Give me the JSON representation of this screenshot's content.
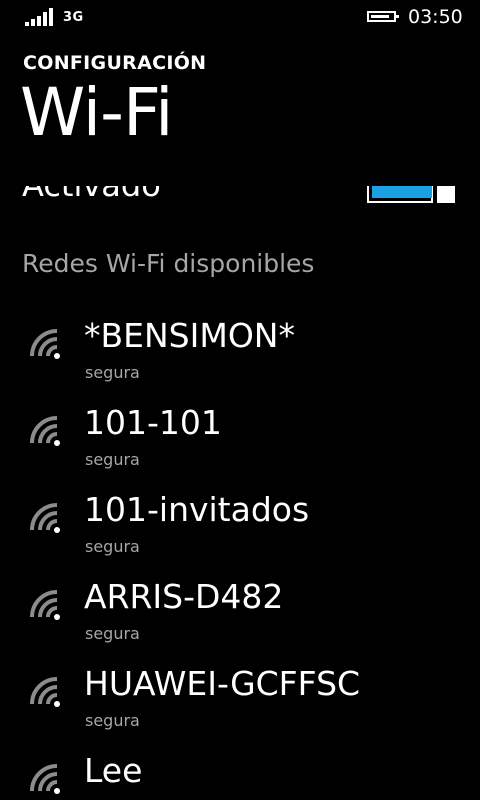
{
  "status_bar": {
    "network": "3G",
    "signal_bars": 5,
    "battery_level": 0.85,
    "time": "03:50"
  },
  "header": {
    "app_title": "CONFIGURACIÓN",
    "page_title": "Wi-Fi"
  },
  "wifi_toggle": {
    "state_label": "Activado",
    "on": true,
    "accent_color": "#1ba1e2"
  },
  "networks_section": {
    "heading": "Redes Wi-Fi disponibles",
    "items": [
      {
        "name": "*BENSIMON*",
        "security": "segura",
        "icon": "wifi-signal-icon"
      },
      {
        "name": "101-101",
        "security": "segura",
        "icon": "wifi-signal-icon"
      },
      {
        "name": "101-invitados",
        "security": "segura",
        "icon": "wifi-signal-icon"
      },
      {
        "name": "ARRIS-D482",
        "security": "segura",
        "icon": "wifi-signal-icon"
      },
      {
        "name": "HUAWEI-GCFFSC",
        "security": "segura",
        "icon": "wifi-signal-icon"
      },
      {
        "name": "Lee",
        "security": "",
        "icon": "wifi-signal-icon"
      }
    ]
  },
  "colors": {
    "background": "#000000",
    "text": "#ffffff",
    "secondary_text": "#a6a6a6",
    "accent": "#1ba1e2"
  }
}
